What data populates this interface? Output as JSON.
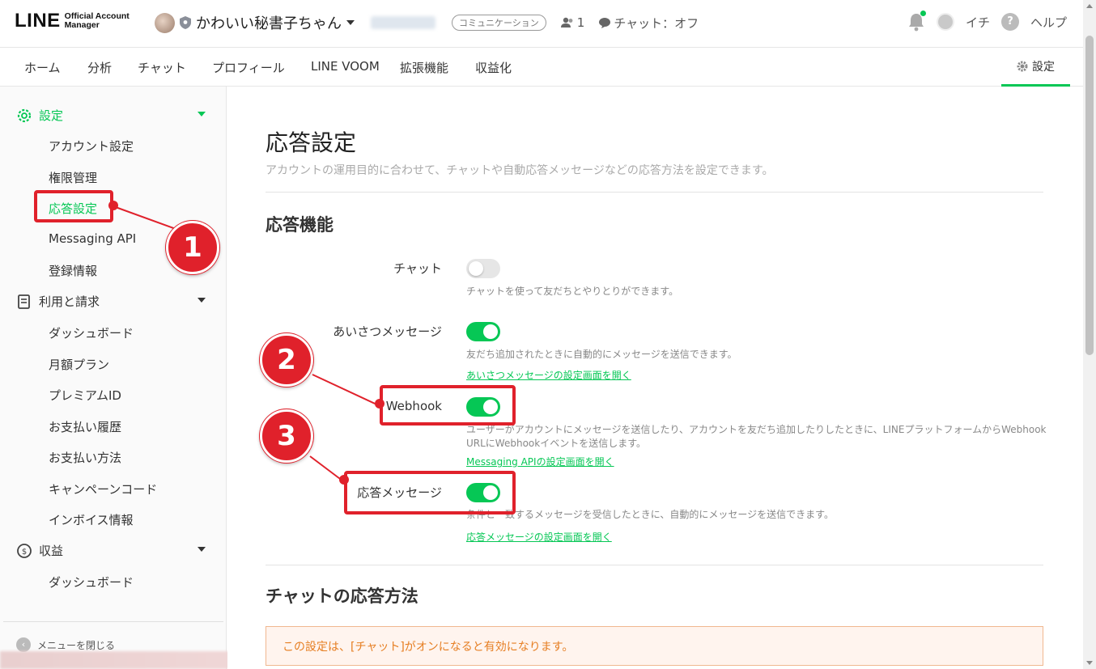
{
  "header": {
    "logo_big": "LINE",
    "logo_small_1": "Official Account",
    "logo_small_2": "Manager",
    "account_name": "かわいい秘書子ちゃん",
    "account_tag": "コミュニケーション",
    "friends_count": "1",
    "chat_status": "チャット：オフ",
    "user_name": "イチ",
    "help_label": "ヘルプ"
  },
  "nav": {
    "items": [
      "ホーム",
      "分析",
      "チャット",
      "プロフィール",
      "LINE VOOM",
      "拡張機能",
      "収益化"
    ],
    "settings_label": "設定"
  },
  "sidebar": {
    "section_settings": "設定",
    "settings_items": [
      "アカウント設定",
      "権限管理",
      "応答設定",
      "Messaging API",
      "登録情報"
    ],
    "section_billing": "利用と請求",
    "billing_items": [
      "ダッシュボード",
      "月額プラン",
      "プレミアムID",
      "お支払い履歴",
      "お支払い方法",
      "キャンペーンコード",
      "インボイス情報"
    ],
    "section_revenue": "収益",
    "revenue_items": [
      "ダッシュボード"
    ],
    "close_menu": "メニューを閉じる"
  },
  "main": {
    "title": "応答設定",
    "description": "アカウントの運用目的に合わせて、チャットや自動応答メッセージなどの応答方法を設定できます。",
    "section_features": "応答機能",
    "rows": [
      {
        "label": "チャット",
        "on": false,
        "help": "チャットを使って友だちとやりとりができます。",
        "link": ""
      },
      {
        "label": "あいさつメッセージ",
        "on": true,
        "help": "友だち追加されたときに自動的にメッセージを送信できます。",
        "link": "あいさつメッセージの設定画面を開く"
      },
      {
        "label": "Webhook",
        "on": true,
        "help": "ユーザーがアカウントにメッセージを送信したり、アカウントを友だち追加したりしたときに、LINEプラットフォームからWebhook URLにWebhookイベントを送信します。",
        "link": "Messaging APIの設定画面を開く"
      },
      {
        "label": "応答メッセージ",
        "on": true,
        "help": "条件と一致するメッセージを受信したときに、自動的にメッセージを送信できます。",
        "link": "応答メッセージの設定画面を開く"
      }
    ],
    "section_chat_method": "チャットの応答方法",
    "notice": "この設定は、[チャット]がオンになると有効になります。"
  },
  "annotations": {
    "colors": {
      "red": "#e0212b",
      "line_green": "#06c755"
    },
    "markers": [
      "1",
      "2",
      "3"
    ]
  }
}
